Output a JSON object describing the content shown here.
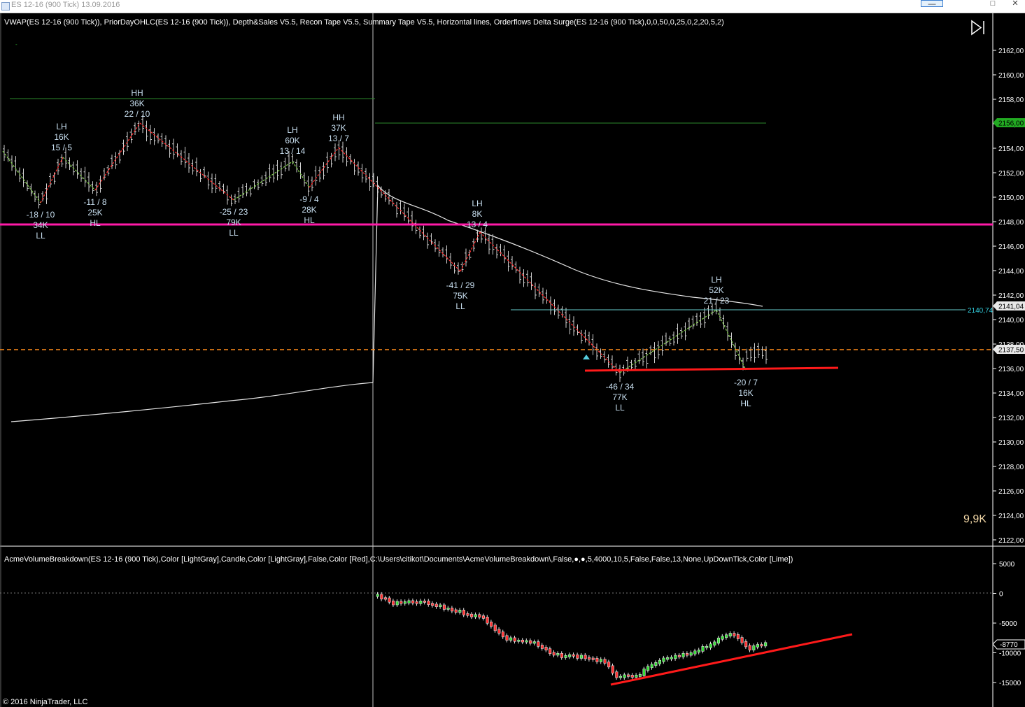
{
  "window": {
    "title": "ES 12-16 (900 Tick)  13.09.2016",
    "controls": [
      "—",
      "□",
      "✕"
    ]
  },
  "price_panel": {
    "indicator_header": "VWAP(ES 12-16 (900 Tick)), PriorDayOHLC(ES 12-16 (900 Tick)), Depth&Sales V5.5, Recon Tape V5.5, Summary Tape V5.5, Horizontal lines,  Orderflows Delta Surge(ES 12-16 (900 Tick),0,0,50,0,25,0,2,20,5,2)",
    "volume_readout": "9,9K",
    "y_axis_ticks": [
      "2162,00",
      "2160,00",
      "2158,00",
      "2156,00",
      "2154,00",
      "2152,00",
      "2150,00",
      "2148,00",
      "2146,00",
      "2144,00",
      "2142,00",
      "2140,00",
      "2138,00",
      "2136,00",
      "2134,00",
      "2132,00",
      "2130,00",
      "2128,00",
      "2126,00",
      "2124,00",
      "2122,00"
    ],
    "price_markers": [
      {
        "text": "2156,00",
        "color": "#22aa22",
        "text_color": "#000000"
      },
      {
        "text": "2141,04",
        "color": "#e8e8e8",
        "text_color": "#000000"
      },
      {
        "text": "2137,50",
        "color": "#e8e8e8",
        "text_color": "#000000"
      }
    ],
    "hline_label": "2140,74",
    "swing_labels": [
      {
        "lines": [
          "HH",
          "36K",
          "22 / 10"
        ]
      },
      {
        "lines": [
          "LH",
          "16K",
          "15 / 5"
        ]
      },
      {
        "lines": [
          "-18 / 10",
          "34K",
          "LL"
        ]
      },
      {
        "lines": [
          "-11 / 8",
          "25K",
          "HL"
        ]
      },
      {
        "lines": [
          "-25 / 23",
          "79K",
          "LL"
        ]
      },
      {
        "lines": [
          "LH",
          "60K",
          "13 / 14"
        ]
      },
      {
        "lines": [
          "-9 / 4",
          "28K",
          "HL"
        ]
      },
      {
        "lines": [
          "HH",
          "37K",
          "13 / 7"
        ]
      },
      {
        "lines": [
          "LH",
          "8K",
          "13 / 4"
        ]
      },
      {
        "lines": [
          "-41 / 29",
          "75K",
          "LL"
        ]
      },
      {
        "lines": [
          "LH",
          "52K",
          "21 / 23"
        ]
      },
      {
        "lines": [
          "-46 / 34",
          "77K",
          "LL"
        ]
      },
      {
        "lines": [
          "-20 / 7",
          "16K",
          "HL"
        ]
      }
    ],
    "colors": {
      "magenta_line": "#ff1aa8",
      "orange_line": "#ff8c1a",
      "red_line": "#ff1a1a",
      "cyan_line": "#66cccc",
      "green_line": "#228822"
    }
  },
  "delta_panel": {
    "indicator_header": "AcmeVolumeBreakdown(ES 12-16 (900 Tick),Color [LightGray],Candle,Color [LightGray],False,Color [Red],C:\\Users\\citikot\\Documents\\AcmeVolumeBreakdown\\,False,●,●,5,4000,10,5,False,False,13,None,UpDownTick,Color [Lime])",
    "y_axis_ticks": [
      "5000",
      "0",
      "-5000",
      "-10000",
      "-15000"
    ],
    "current_value": "-8770"
  },
  "footer": {
    "copyright": "© 2016 NinjaTrader, LLC"
  }
}
